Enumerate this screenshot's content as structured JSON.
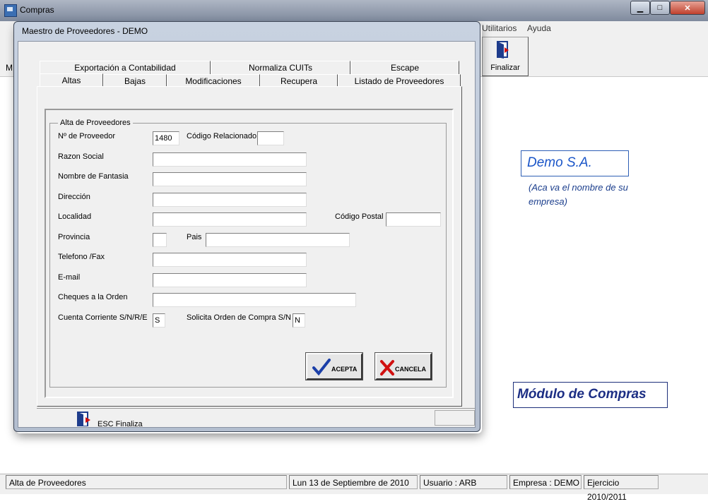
{
  "main_window": {
    "title": "Compras",
    "controls": {
      "minimize": "▁",
      "maximize": "□",
      "close": "✕"
    },
    "menu": [
      "Utilitarios",
      "Ayuda"
    ],
    "left_menu_fragment": "M",
    "toolbar": {
      "finalizar_label": "Finalizar"
    }
  },
  "company": {
    "name": "Demo S.A.",
    "note": "(Aca va el nombre de su empresa)"
  },
  "module_title": "Módulo de Compras",
  "dialog": {
    "title": "Maestro de Proveedores  - DEMO",
    "tabs_back": [
      "Exportación a Contabilidad",
      "Normaliza CUITs",
      "Escape"
    ],
    "tabs_front": [
      "Altas",
      "Bajas",
      "Modificaciones",
      "Recupera",
      "Listado de Proveedores"
    ],
    "group_title": "Alta de Proveedores",
    "labels": {
      "nro_proveedor": "Nº de Proveedor",
      "codigo_relacionado": "Código Relacionado",
      "razon_social": "Razon Social",
      "nombre_fantasia": "Nombre de Fantasia",
      "direccion": "Dirección",
      "localidad": "Localidad",
      "codigo_postal": "Código Postal",
      "provincia": "Provincia",
      "pais": "Pais",
      "telefono": "Telefono /Fax",
      "email": "E-mail",
      "cheques": "Cheques a la Orden",
      "cuenta_corriente": "Cuenta Corriente  S/N/R/E",
      "solicita_orden": "Solicita Orden de Compra S/N"
    },
    "values": {
      "nro_proveedor": "1480",
      "codigo_relacionado": "",
      "razon_social": "",
      "nombre_fantasia": "",
      "direccion": "",
      "localidad": "",
      "codigo_postal": "",
      "provincia": "",
      "pais": "",
      "telefono": "",
      "email": "",
      "cheques": "",
      "cuenta_corriente": "S",
      "solicita_orden": "N"
    },
    "buttons": {
      "acepta": "ACEPTA",
      "cancela": "CANCELA"
    },
    "footer_esc": "ESC Finaliza"
  },
  "statusbar": {
    "screen": "Alta de Proveedores",
    "date": "Lun 13 de Septiembre de 2010",
    "user": "Usuario : ARB",
    "company": "Empresa : DEMO",
    "period": "Ejercicio 2010/2011"
  },
  "colors": {
    "company_text": "#1a55c8",
    "module_text": "#1c2e84"
  }
}
